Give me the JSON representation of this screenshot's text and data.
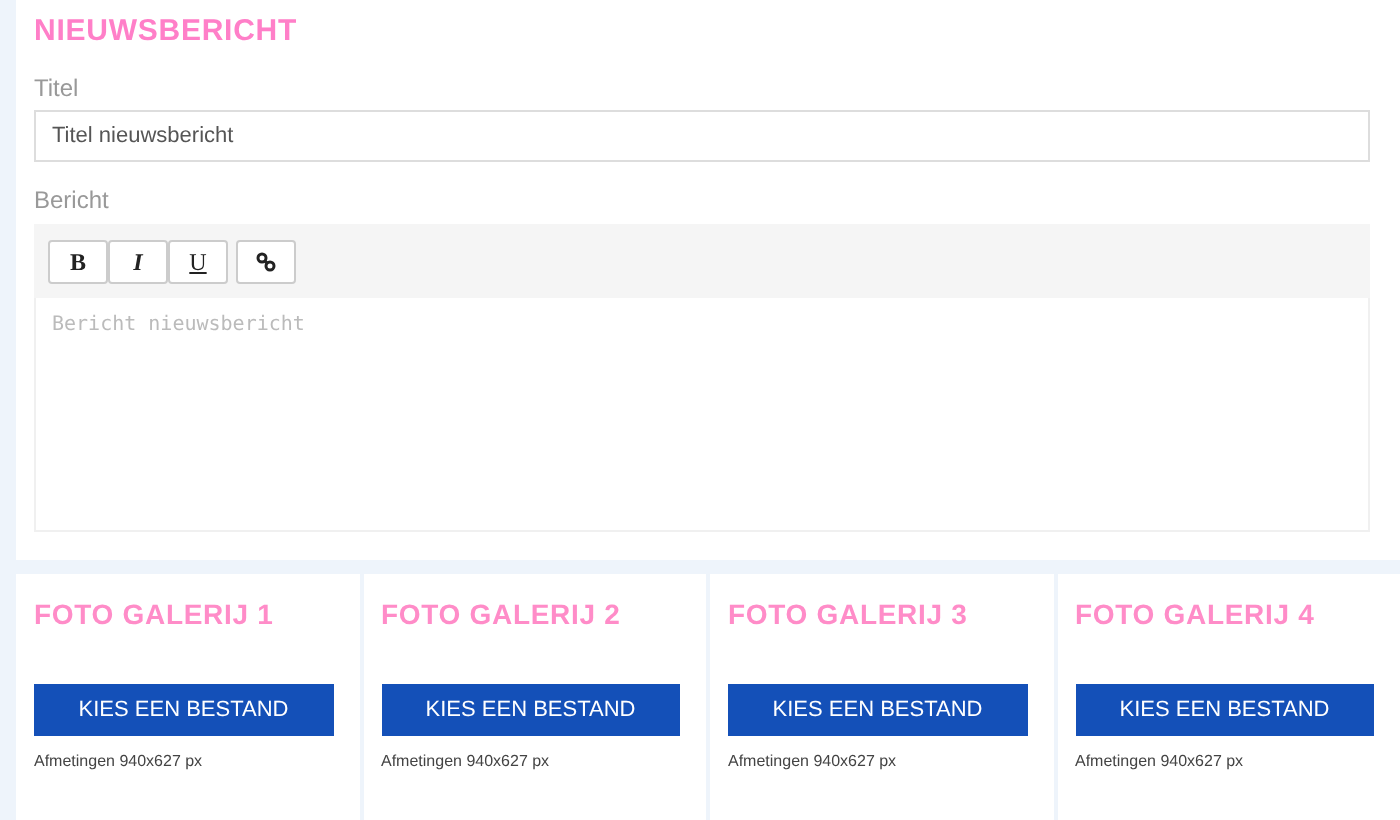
{
  "news": {
    "heading": "NIEUWSBERICHT",
    "title_label": "Titel",
    "title_value": "Titel nieuwsbericht",
    "message_label": "Bericht",
    "toolbar": [
      {
        "kind": "bold",
        "label": "B"
      },
      {
        "kind": "italic",
        "label": "I"
      },
      {
        "kind": "underline",
        "label": "U"
      },
      {
        "kind": "link"
      }
    ],
    "editor_placeholder": "Bericht nieuwsbericht"
  },
  "galleries": [
    {
      "heading": "FOTO GALERIJ 1",
      "button": "KIES EEN BESTAND",
      "note": "Afmetingen 940x627 px"
    },
    {
      "heading": "FOTO GALERIJ 2",
      "button": "KIES EEN BESTAND",
      "note": "Afmetingen 940x627 px"
    },
    {
      "heading": "FOTO GALERIJ 3",
      "button": "KIES EEN BESTAND",
      "note": "Afmetingen 940x627 px"
    },
    {
      "heading": "FOTO GALERIJ 4",
      "button": "KIES EEN BESTAND",
      "note": "Afmetingen 940x627 px"
    }
  ]
}
